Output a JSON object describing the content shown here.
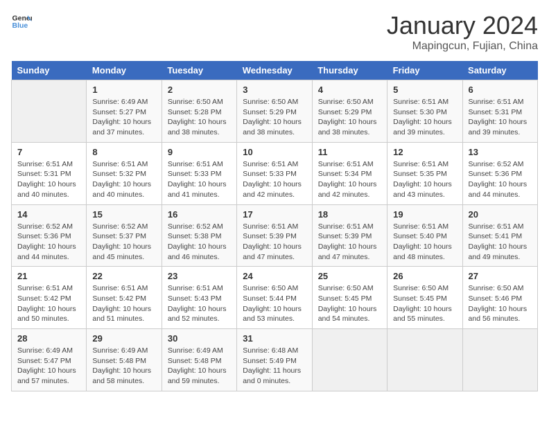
{
  "header": {
    "logo_line1": "General",
    "logo_line2": "Blue",
    "month": "January 2024",
    "location": "Mapingcun, Fujian, China"
  },
  "days_of_week": [
    "Sunday",
    "Monday",
    "Tuesday",
    "Wednesday",
    "Thursday",
    "Friday",
    "Saturday"
  ],
  "weeks": [
    [
      {
        "day": "",
        "empty": true
      },
      {
        "day": "1",
        "sunrise": "6:49 AM",
        "sunset": "5:27 PM",
        "daylight": "10 hours and 37 minutes."
      },
      {
        "day": "2",
        "sunrise": "6:50 AM",
        "sunset": "5:28 PM",
        "daylight": "10 hours and 38 minutes."
      },
      {
        "day": "3",
        "sunrise": "6:50 AM",
        "sunset": "5:29 PM",
        "daylight": "10 hours and 38 minutes."
      },
      {
        "day": "4",
        "sunrise": "6:50 AM",
        "sunset": "5:29 PM",
        "daylight": "10 hours and 38 minutes."
      },
      {
        "day": "5",
        "sunrise": "6:51 AM",
        "sunset": "5:30 PM",
        "daylight": "10 hours and 39 minutes."
      },
      {
        "day": "6",
        "sunrise": "6:51 AM",
        "sunset": "5:31 PM",
        "daylight": "10 hours and 39 minutes."
      }
    ],
    [
      {
        "day": "7",
        "sunrise": "6:51 AM",
        "sunset": "5:31 PM",
        "daylight": "10 hours and 40 minutes."
      },
      {
        "day": "8",
        "sunrise": "6:51 AM",
        "sunset": "5:32 PM",
        "daylight": "10 hours and 40 minutes."
      },
      {
        "day": "9",
        "sunrise": "6:51 AM",
        "sunset": "5:33 PM",
        "daylight": "10 hours and 41 minutes."
      },
      {
        "day": "10",
        "sunrise": "6:51 AM",
        "sunset": "5:33 PM",
        "daylight": "10 hours and 42 minutes."
      },
      {
        "day": "11",
        "sunrise": "6:51 AM",
        "sunset": "5:34 PM",
        "daylight": "10 hours and 42 minutes."
      },
      {
        "day": "12",
        "sunrise": "6:51 AM",
        "sunset": "5:35 PM",
        "daylight": "10 hours and 43 minutes."
      },
      {
        "day": "13",
        "sunrise": "6:52 AM",
        "sunset": "5:36 PM",
        "daylight": "10 hours and 44 minutes."
      }
    ],
    [
      {
        "day": "14",
        "sunrise": "6:52 AM",
        "sunset": "5:36 PM",
        "daylight": "10 hours and 44 minutes."
      },
      {
        "day": "15",
        "sunrise": "6:52 AM",
        "sunset": "5:37 PM",
        "daylight": "10 hours and 45 minutes."
      },
      {
        "day": "16",
        "sunrise": "6:52 AM",
        "sunset": "5:38 PM",
        "daylight": "10 hours and 46 minutes."
      },
      {
        "day": "17",
        "sunrise": "6:51 AM",
        "sunset": "5:39 PM",
        "daylight": "10 hours and 47 minutes."
      },
      {
        "day": "18",
        "sunrise": "6:51 AM",
        "sunset": "5:39 PM",
        "daylight": "10 hours and 47 minutes."
      },
      {
        "day": "19",
        "sunrise": "6:51 AM",
        "sunset": "5:40 PM",
        "daylight": "10 hours and 48 minutes."
      },
      {
        "day": "20",
        "sunrise": "6:51 AM",
        "sunset": "5:41 PM",
        "daylight": "10 hours and 49 minutes."
      }
    ],
    [
      {
        "day": "21",
        "sunrise": "6:51 AM",
        "sunset": "5:42 PM",
        "daylight": "10 hours and 50 minutes."
      },
      {
        "day": "22",
        "sunrise": "6:51 AM",
        "sunset": "5:42 PM",
        "daylight": "10 hours and 51 minutes."
      },
      {
        "day": "23",
        "sunrise": "6:51 AM",
        "sunset": "5:43 PM",
        "daylight": "10 hours and 52 minutes."
      },
      {
        "day": "24",
        "sunrise": "6:50 AM",
        "sunset": "5:44 PM",
        "daylight": "10 hours and 53 minutes."
      },
      {
        "day": "25",
        "sunrise": "6:50 AM",
        "sunset": "5:45 PM",
        "daylight": "10 hours and 54 minutes."
      },
      {
        "day": "26",
        "sunrise": "6:50 AM",
        "sunset": "5:45 PM",
        "daylight": "10 hours and 55 minutes."
      },
      {
        "day": "27",
        "sunrise": "6:50 AM",
        "sunset": "5:46 PM",
        "daylight": "10 hours and 56 minutes."
      }
    ],
    [
      {
        "day": "28",
        "sunrise": "6:49 AM",
        "sunset": "5:47 PM",
        "daylight": "10 hours and 57 minutes."
      },
      {
        "day": "29",
        "sunrise": "6:49 AM",
        "sunset": "5:48 PM",
        "daylight": "10 hours and 58 minutes."
      },
      {
        "day": "30",
        "sunrise": "6:49 AM",
        "sunset": "5:48 PM",
        "daylight": "10 hours and 59 minutes."
      },
      {
        "day": "31",
        "sunrise": "6:48 AM",
        "sunset": "5:49 PM",
        "daylight": "11 hours and 0 minutes."
      },
      {
        "day": "",
        "empty": true
      },
      {
        "day": "",
        "empty": true
      },
      {
        "day": "",
        "empty": true
      }
    ]
  ],
  "labels": {
    "sunrise": "Sunrise:",
    "sunset": "Sunset:",
    "daylight": "Daylight:"
  }
}
